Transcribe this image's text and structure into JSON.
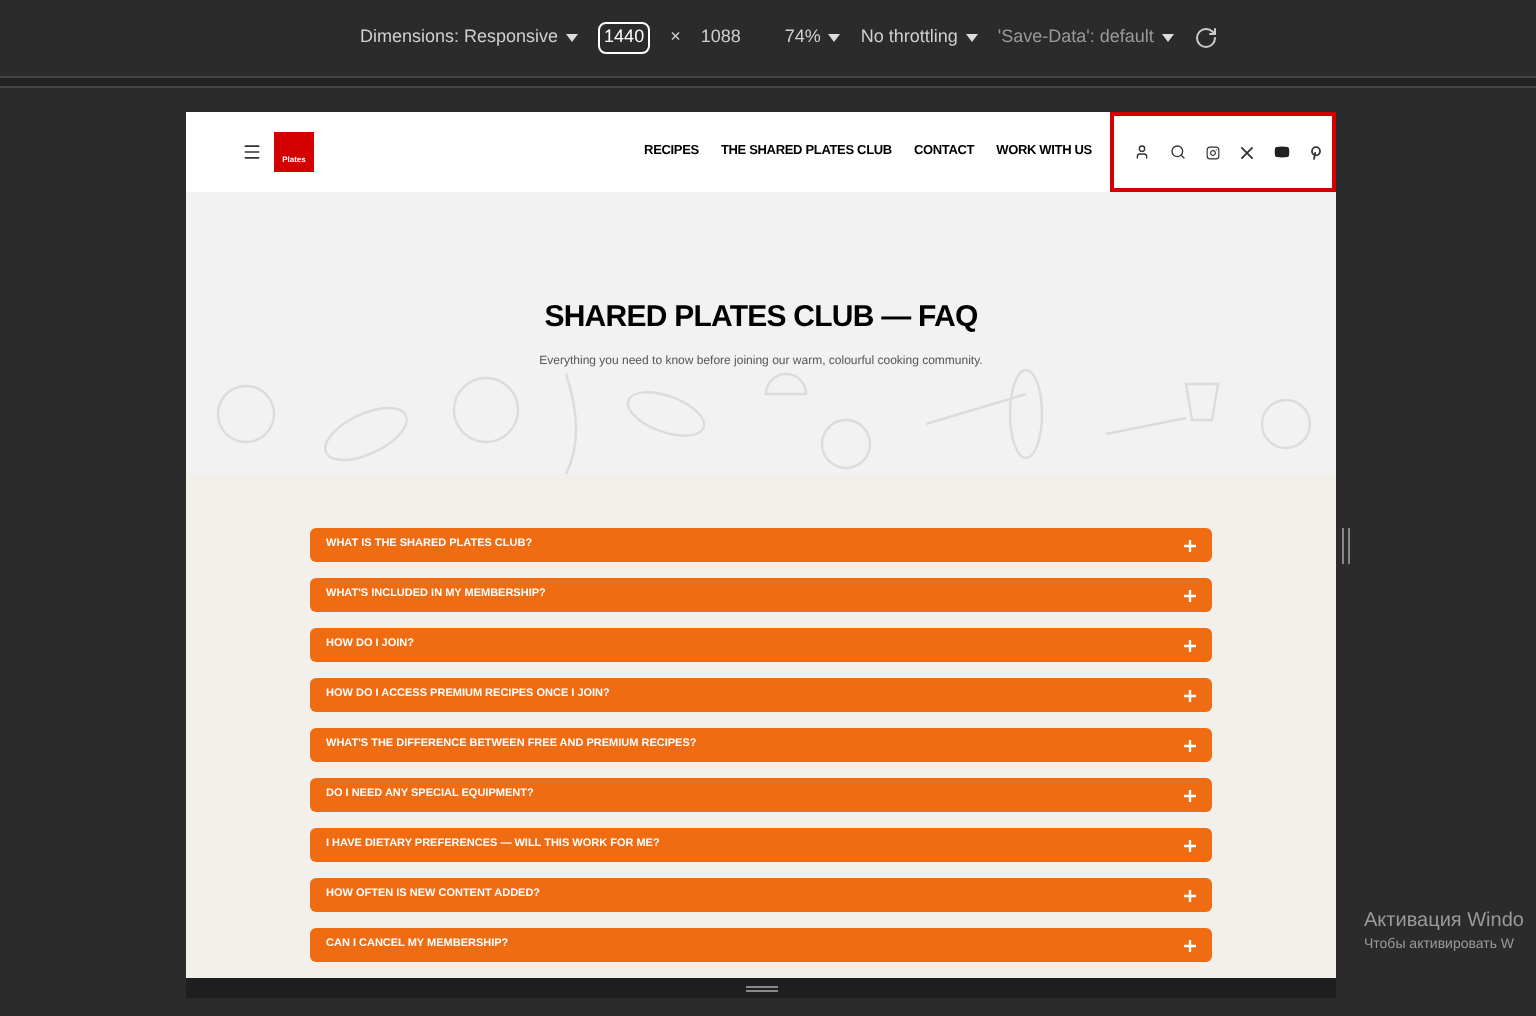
{
  "devtools_toolbar": {
    "dimensions_label": "Dimensions: Responsive",
    "width_value": "1440",
    "times": "×",
    "height_value": "1088",
    "zoom": "74%",
    "throttling": "No throttling",
    "save_data": "'Save-Data': default"
  },
  "header": {
    "logo_text": "Plates",
    "nav": [
      "RECIPES",
      "THE SHARED PLATES CLUB",
      "CONTACT",
      "WORK WITH US"
    ]
  },
  "hero": {
    "title": "SHARED PLATES CLUB — FAQ",
    "subtitle": "Everything you need to know before joining our warm, colourful cooking community."
  },
  "faq": [
    {
      "question": "WHAT IS THE SHARED PLATES CLUB?",
      "expanded": false
    },
    {
      "question": "WHAT'S INCLUDED IN MY MEMBERSHIP?",
      "expanded": false
    },
    {
      "question": "HOW DO I JOIN?",
      "expanded": false
    },
    {
      "question": "HOW DO I ACCESS PREMIUM RECIPES ONCE I JOIN?",
      "expanded": false
    },
    {
      "question": "WHAT'S THE DIFFERENCE BETWEEN FREE AND PREMIUM RECIPES?",
      "expanded": false
    },
    {
      "question": "DO I NEED ANY SPECIAL EQUIPMENT?",
      "expanded": false
    },
    {
      "question": "I HAVE DIETARY PREFERENCES — WILL THIS WORK FOR ME?",
      "expanded": false
    },
    {
      "question": "HOW OFTEN IS NEW CONTENT ADDED?",
      "expanded": false
    },
    {
      "question": "CAN I CANCEL MY MEMBERSHIP?",
      "expanded": false
    }
  ],
  "os_notice": {
    "title": "Активация Windo",
    "text": "Чтобы активировать W"
  }
}
